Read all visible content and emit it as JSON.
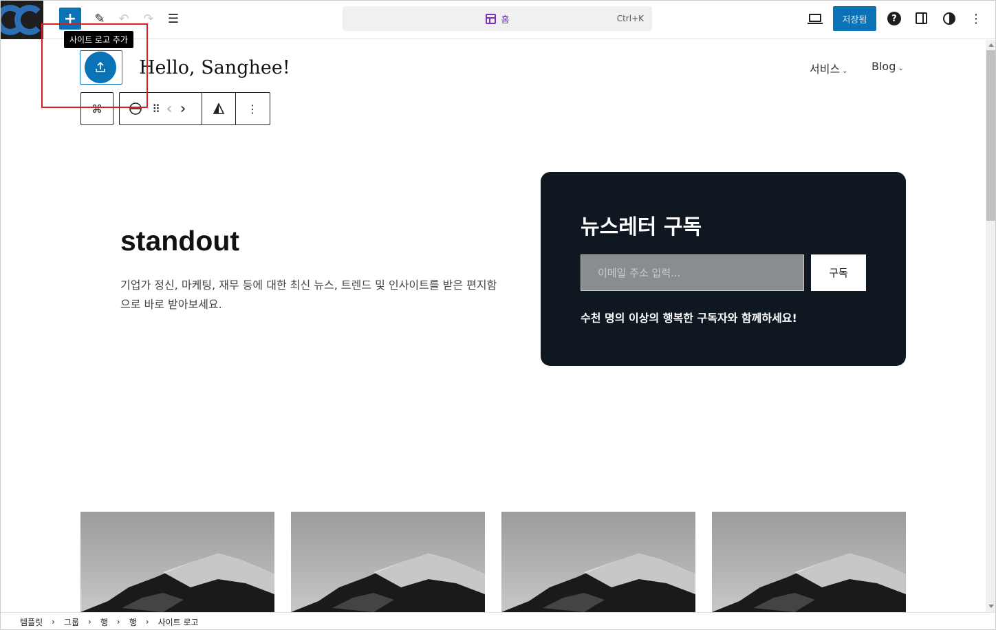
{
  "toolbar": {
    "add_symbol": "+",
    "pencil_symbol": "✎",
    "undo_symbol": "↶",
    "redo_symbol": "↷",
    "list_view_symbol": "☰",
    "command_title": "홈",
    "command_shortcut": "Ctrl+K",
    "save_label": "저장됨",
    "help_symbol": "?",
    "more_symbol": "⋮"
  },
  "tooltip": "사이트 로고 추가",
  "header": {
    "site_title": "Hello, Sanghee!",
    "nav": [
      {
        "label": "서비스"
      },
      {
        "label": "Blog"
      }
    ],
    "chevron": "⌄"
  },
  "block_toolbar": {
    "transform_symbol": "⌘",
    "drag_symbol": "⠿",
    "move_left_symbol": "‹",
    "move_right_symbol": "›",
    "more_symbol": "⋮"
  },
  "hero": {
    "heading": "standout",
    "description": "기업가 정신, 마케팅, 재무 등에 대한 최신 뉴스, 트렌드 및 인사이트를 받은 편지함으로 바로 받아보세요."
  },
  "newsletter": {
    "title": "뉴스레터 구독",
    "input_placeholder": "이메일 주소 입력...",
    "button_label": "구독",
    "note": "수천 명의 이상의 행복한 구독자와 함께하세요!"
  },
  "breadcrumb": [
    "템플릿",
    "그룹",
    "행",
    "행",
    "사이트 로고"
  ],
  "breadcrumb_sep": "›",
  "colors": {
    "accent": "#0a73b7",
    "template_purple": "#7a2fc0",
    "newsletter_bg": "#0f1720",
    "annotation_red": "#e01b1b"
  }
}
